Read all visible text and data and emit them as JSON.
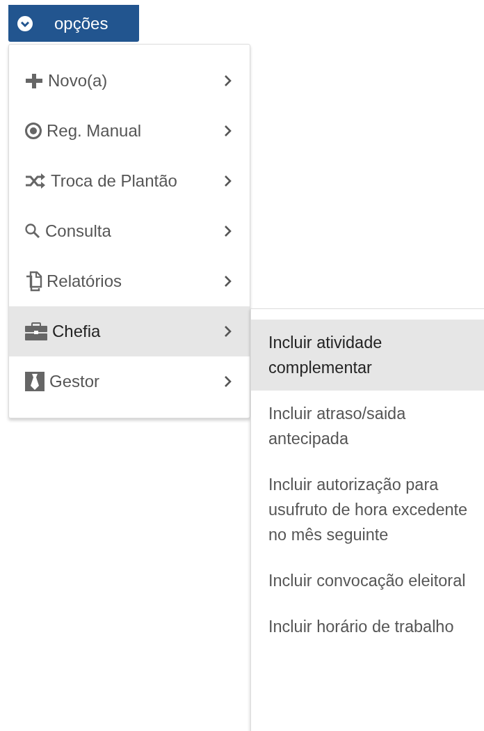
{
  "options_button": {
    "label": "opções"
  },
  "menu": [
    {
      "label": "Novo(a)",
      "selected": false
    },
    {
      "label": "Reg. Manual",
      "selected": false
    },
    {
      "label": "Troca de Plantão",
      "selected": false
    },
    {
      "label": "Consulta",
      "selected": false
    },
    {
      "label": "Relatórios",
      "selected": false
    },
    {
      "label": "Chefia",
      "selected": true
    },
    {
      "label": "Gestor",
      "selected": false
    }
  ],
  "submenu": [
    {
      "label": "Incluir atividade complementar",
      "selected": true
    },
    {
      "label": "Incluir atraso/saida antecipada",
      "selected": false
    },
    {
      "label": "Incluir autorização para usufruto de hora excedente no mês seguinte",
      "selected": false
    },
    {
      "label": "Incluir convocação eleitoral",
      "selected": false
    },
    {
      "label": "Incluir horário de trabalho",
      "selected": false
    }
  ]
}
